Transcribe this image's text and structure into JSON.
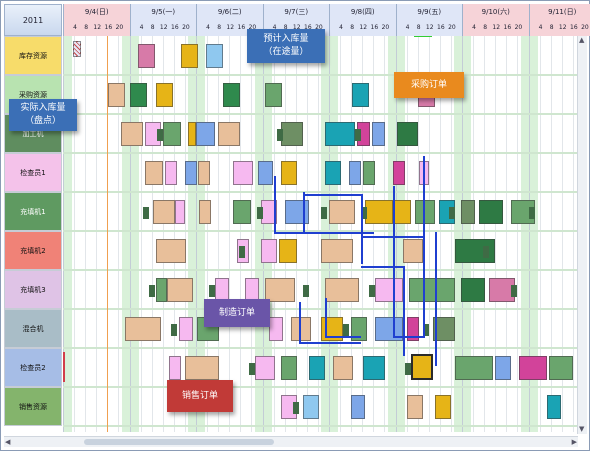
{
  "year": "2011",
  "days": [
    {
      "label": "9/4(日)",
      "color": "#f6d3d8"
    },
    {
      "label": "9/5(一)",
      "color": "#dfe6f7"
    },
    {
      "label": "9/6(二)",
      "color": "#dfe6f7"
    },
    {
      "label": "9/7(三)",
      "color": "#dfe6f7"
    },
    {
      "label": "9/8(四)",
      "color": "#dfe6f7"
    },
    {
      "label": "9/9(五)",
      "color": "#dfe6f7"
    },
    {
      "label": "9/10(六)",
      "color": "#f6d3d8"
    },
    {
      "label": "9/11(日)",
      "color": "#f6d3d8"
    }
  ],
  "hour_ticks": [
    "4",
    "8",
    "12",
    "16",
    "20"
  ],
  "resources": [
    {
      "label": "库存资源",
      "color": "#f7dc6a"
    },
    {
      "label": "采购资源",
      "color": "#b8e3b0"
    },
    {
      "label": "加工机",
      "color": "#5f8d5f"
    },
    {
      "label": "检查员1",
      "color": "#f4c2ea"
    },
    {
      "label": "充填机1",
      "color": "#5f9a61"
    },
    {
      "label": "充填机2",
      "color": "#f08277"
    },
    {
      "label": "充填机3",
      "color": "#dfc3e6"
    },
    {
      "label": "混合机",
      "color": "#a9bdc7"
    },
    {
      "label": "检查员2",
      "color": "#a6bde6"
    },
    {
      "label": "销售资源",
      "color": "#84b46c"
    }
  ],
  "callouts": {
    "planned_inbound": "预计入库量\n（在途量）",
    "purchase_order": "采购订单",
    "actual_inbound": "实际入库量\n（盘点）",
    "manufacturing_order": "制造订单",
    "sales_order": "销售订单"
  }
}
